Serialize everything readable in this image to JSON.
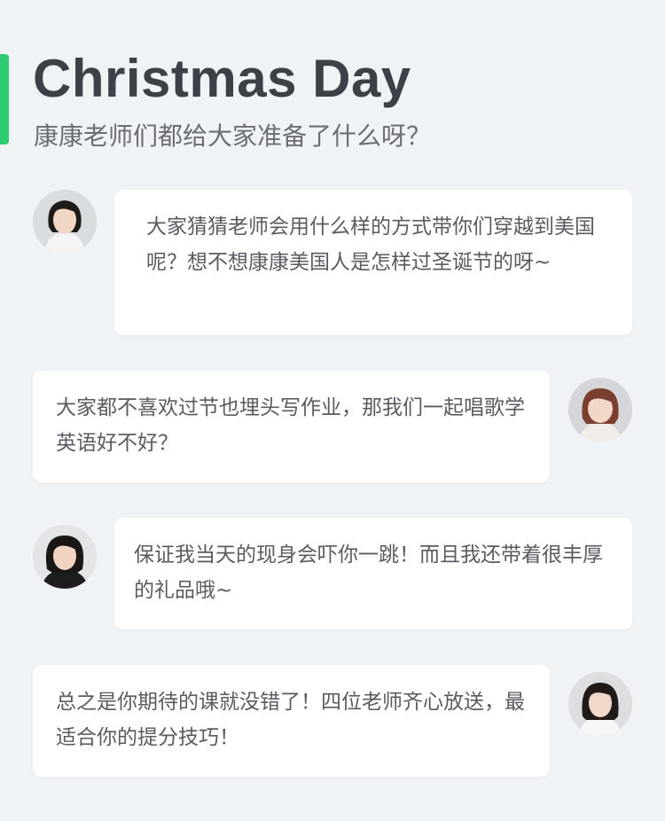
{
  "header": {
    "title": "Christmas Day",
    "subtitle": "康康老师们都给大家准备了什么呀？"
  },
  "messages": [
    {
      "side": "left",
      "text": "大家猜猜老师会用什么样的方式带你们穿越到美国呢？想不想康康美国人是怎样过圣诞节的呀~"
    },
    {
      "side": "right",
      "text": "大家都不喜欢过节也埋头写作业，那我们一起唱歌学英语好不好？"
    },
    {
      "side": "left",
      "text": "保证我当天的现身会吓你一跳！而且我还带着很丰厚的礼品哦~"
    },
    {
      "side": "right",
      "text": "总之是你期待的课就没错了！四位老师齐心放送，最适合你的提分技巧！"
    }
  ],
  "colors": {
    "background": "#f0f3f6",
    "accent": "#2ecc71",
    "bubble": "#ffffff",
    "title": "#3d4047",
    "text": "#585b60"
  }
}
